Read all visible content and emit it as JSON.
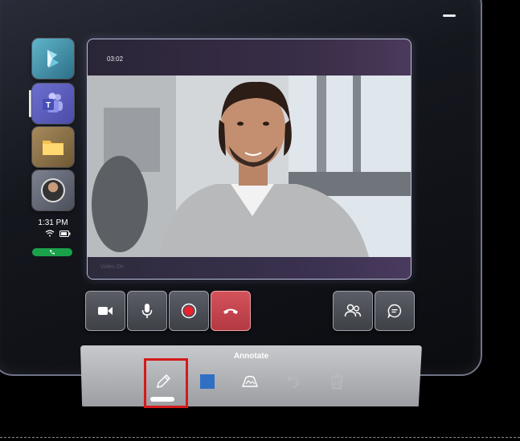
{
  "call": {
    "timer": "03:02",
    "caption": "Video On"
  },
  "status": {
    "time": "1:31 PM"
  },
  "apps": [
    {
      "name": "Dynamics 365",
      "icon": "dynamics-icon"
    },
    {
      "name": "Teams",
      "icon": "teams-icon",
      "active": true
    },
    {
      "name": "Files",
      "icon": "folder-icon"
    },
    {
      "name": "Contact",
      "icon": "avatar"
    }
  ],
  "controls": [
    {
      "id": "camera",
      "icon": "camera-icon"
    },
    {
      "id": "microphone",
      "icon": "microphone-icon"
    },
    {
      "id": "record",
      "icon": "record-icon"
    },
    {
      "id": "end-call",
      "icon": "hang-up-icon",
      "color": "#c8444d"
    },
    {
      "id": "participants",
      "icon": "people-icon"
    },
    {
      "id": "chat",
      "icon": "chat-icon"
    }
  ],
  "annotate": {
    "title": "Annotate",
    "tools": [
      {
        "id": "pen",
        "icon": "pen-icon",
        "selected": true
      },
      {
        "id": "color",
        "icon": "color-square-icon",
        "color": "#2f6fc4"
      },
      {
        "id": "mixed-reality",
        "icon": "mixed-reality-icon"
      },
      {
        "id": "undo",
        "icon": "undo-icon",
        "enabled": false
      },
      {
        "id": "delete",
        "icon": "trash-icon",
        "enabled": false
      }
    ]
  }
}
